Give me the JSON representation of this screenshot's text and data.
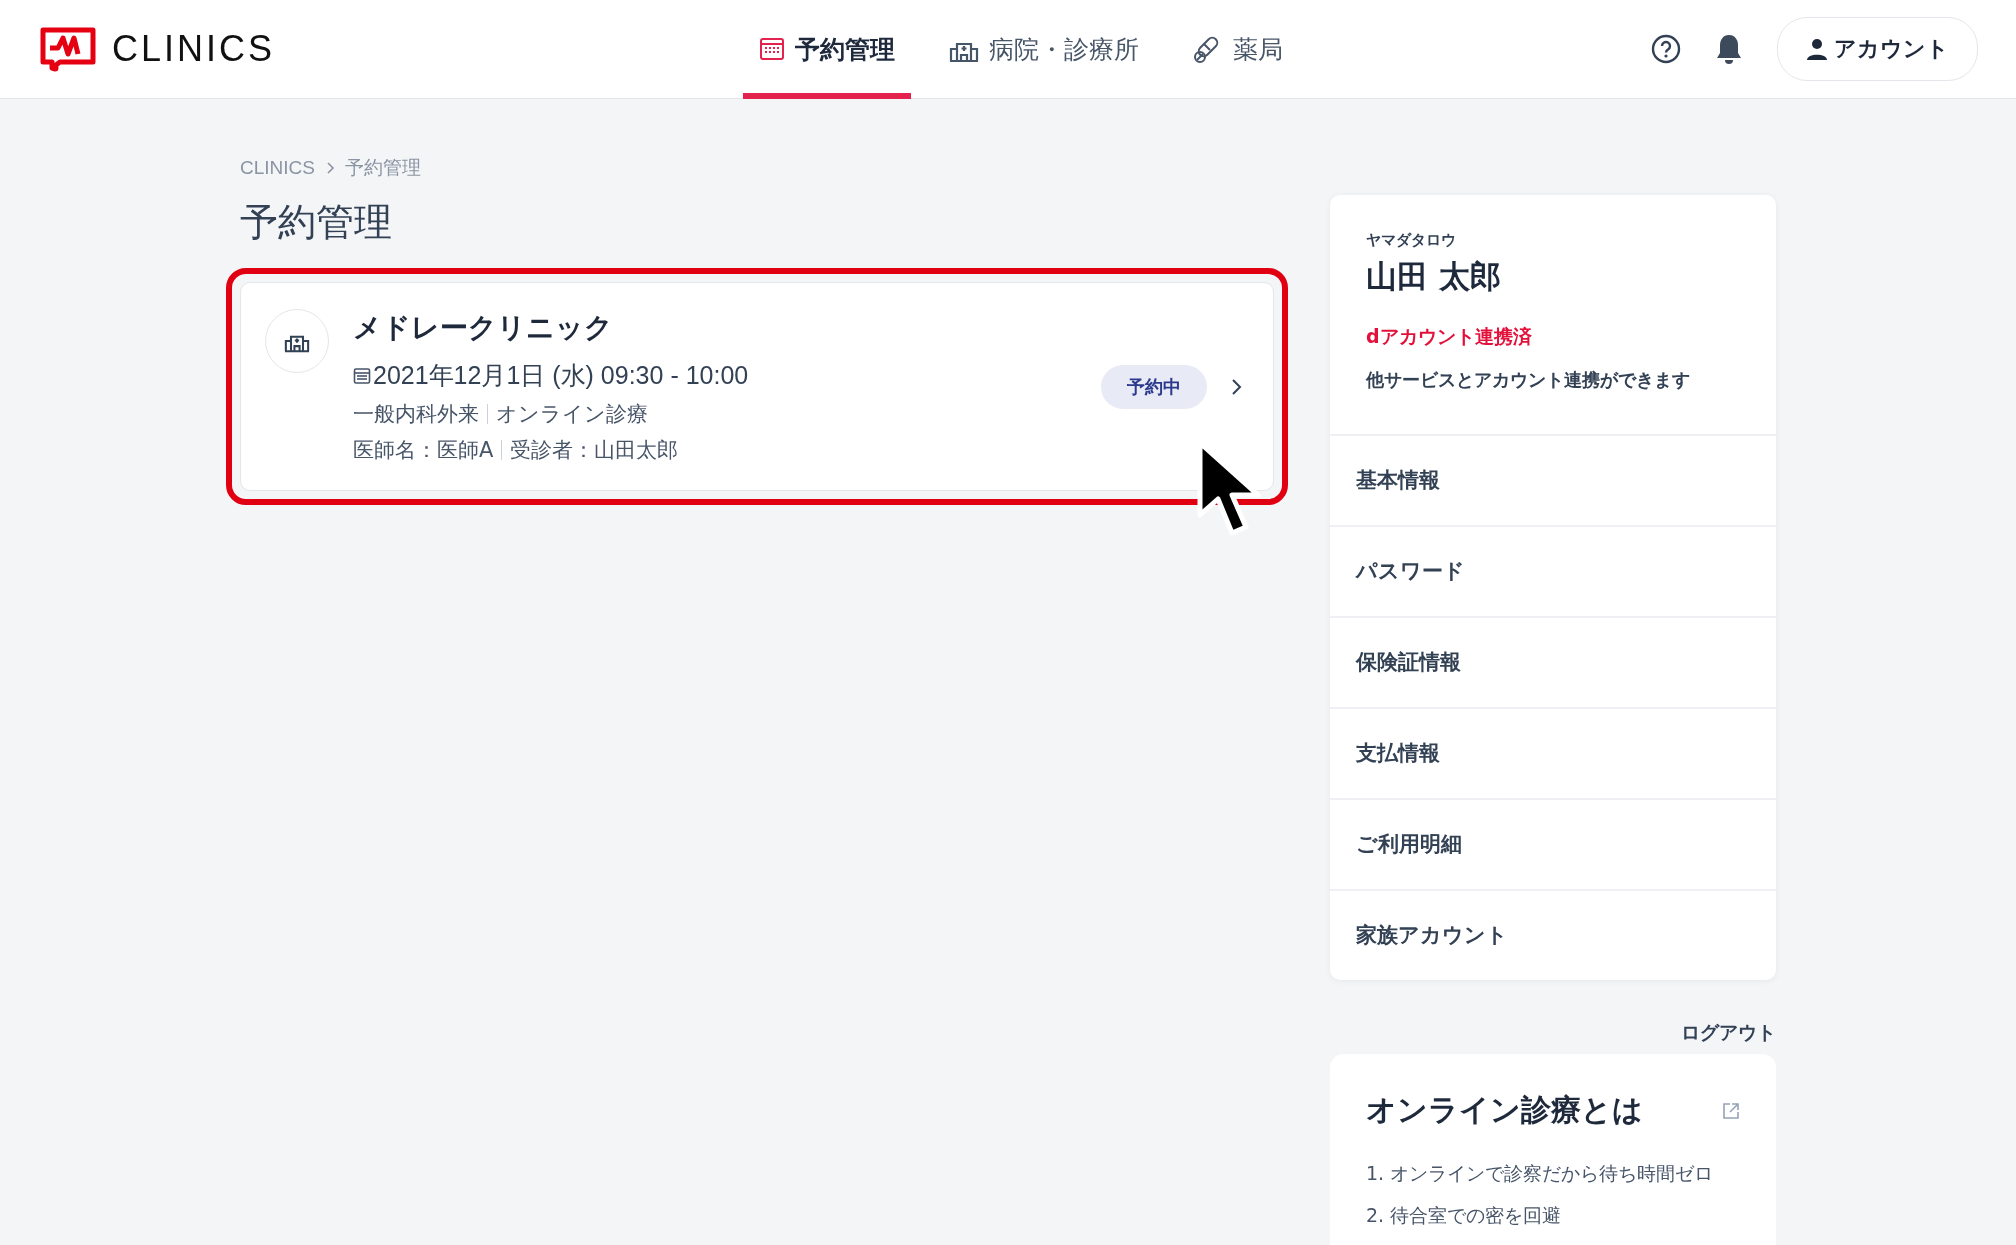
{
  "header": {
    "logo_text": "CLINICS",
    "nav": [
      {
        "label": "予約管理",
        "selected": true
      },
      {
        "label": "病院・診療所",
        "selected": false
      },
      {
        "label": "薬局",
        "selected": false
      }
    ],
    "account_button": "アカウント"
  },
  "breadcrumb": [
    "CLINICS",
    "予約管理"
  ],
  "page_title": "予約管理",
  "reservations": [
    {
      "clinic": "メドレークリニック",
      "date": "2021年12月1日 (水) 09:30 - 10:00",
      "details": [
        "一般内科外来",
        "オンライン診療"
      ],
      "people": [
        "医師名：医師A",
        "受診者：山田太郎"
      ],
      "status": "予約中",
      "highlighted": true
    }
  ],
  "profile": {
    "kana": "ヤマダタロウ",
    "name": "山田 太郎",
    "link_status": "dアカウント連携済",
    "link_note": "他サービスとアカウント連携ができます"
  },
  "menu": [
    "基本情報",
    "パスワード",
    "保険証情報",
    "支払情報",
    "ご利用明細",
    "家族アカウント"
  ],
  "logout": "ログアウト",
  "info": {
    "title": "オンライン診療とは",
    "items": [
      "1. オンラインで診察だから待ち時間ゼロ",
      "2. 待合室での密を回避"
    ]
  }
}
